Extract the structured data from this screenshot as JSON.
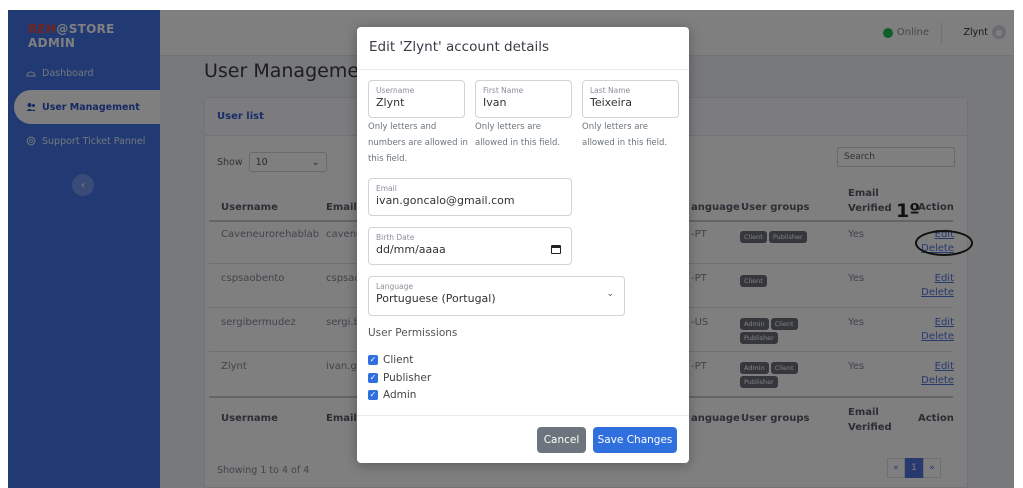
{
  "sidebar": {
    "brand_prefix": "REH",
    "brand_suffix": "@STORE ADMIN",
    "items": [
      {
        "label": "Dashboard"
      },
      {
        "label": "User Management"
      },
      {
        "label": "Support Ticket Pannel"
      }
    ],
    "collapse_icon": "‹"
  },
  "topbar": {
    "status": "Online",
    "user": "Zlynt"
  },
  "page": {
    "title": "User Management",
    "card_title": "User list",
    "show_label": "Show",
    "show_value": "10",
    "search_placeholder": "Search",
    "footer": "Showing 1 to 4 of 4",
    "pager": {
      "prev": "«",
      "current": "1",
      "next": "»"
    }
  },
  "table": {
    "headers": {
      "username": "Username",
      "email": "Email",
      "language": "Language",
      "groups": "User groups",
      "verified": "Email Verified",
      "action": "Action"
    },
    "header_email_visible": "Email",
    "header_language_visible": "anguage",
    "rows": [
      {
        "username": "Caveneurorehablab",
        "email": "cavene",
        "language": "-PT",
        "groups": [
          "Client",
          "Publisher"
        ],
        "verified": "Yes",
        "edit": "Edit",
        "delete": "Delete"
      },
      {
        "username": "cspsaobento",
        "email": "cspsac",
        "language": "-PT",
        "groups": [
          "Client"
        ],
        "verified": "Yes",
        "edit": "Edit",
        "delete": "Delete"
      },
      {
        "username": "sergibermudez",
        "email": "sergi.b",
        "language": "-US",
        "groups": [
          "Admin",
          "Client",
          "Publisher"
        ],
        "verified": "Yes",
        "edit": "Edit",
        "delete": "Delete"
      },
      {
        "username": "Zlynt",
        "email": "ivan.gc",
        "language": "-PT",
        "groups": [
          "Admin",
          "Client",
          "Publisher"
        ],
        "verified": "Yes",
        "edit": "Edit",
        "delete": "Delete"
      }
    ]
  },
  "annotation": {
    "number": "1º"
  },
  "modal": {
    "title": "Edit 'Zlynt' account details",
    "username": {
      "label": "Username",
      "value": "Zlynt",
      "help": "Only letters and numbers are allowed in this field."
    },
    "first_name": {
      "label": "First Name",
      "value": "Ivan",
      "help": "Only letters are allowed in this field."
    },
    "last_name": {
      "label": "Last Name",
      "value": "Teixeira",
      "help": "Only letters are allowed in this field."
    },
    "email": {
      "label": "Email",
      "value": "ivan.goncalo@gmail.com"
    },
    "birth": {
      "label": "Birth Date",
      "value": "dd/mm/aaaa"
    },
    "language": {
      "label": "Language",
      "value": "Portuguese (Portugal)"
    },
    "permissions_title": "User Permissions",
    "permissions": [
      {
        "label": "Client",
        "checked": true
      },
      {
        "label": "Publisher",
        "checked": true
      },
      {
        "label": "Admin",
        "checked": true
      }
    ],
    "cancel": "Cancel",
    "save": "Save Changes"
  },
  "colors": {
    "sidebar": "#4474e6",
    "primary": "#2f6fde",
    "online": "#1fbf52",
    "brand_red": "#e5493a"
  }
}
